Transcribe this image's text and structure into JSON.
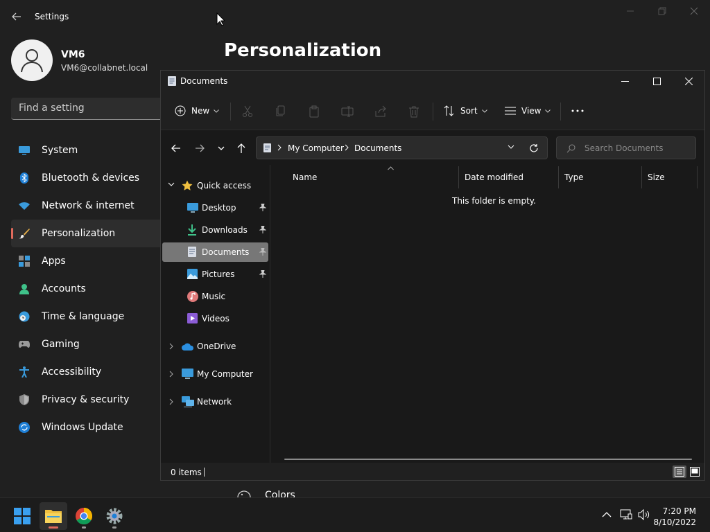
{
  "settings": {
    "title": "Settings",
    "profile": {
      "name": "VM6",
      "email": "VM6@collabnet.local"
    },
    "search_placeholder": "Find a setting",
    "page_title": "Personalization",
    "nav": [
      {
        "label": "System",
        "icon": "monitor-icon"
      },
      {
        "label": "Bluetooth & devices",
        "icon": "bluetooth-icon"
      },
      {
        "label": "Network & internet",
        "icon": "wifi-icon"
      },
      {
        "label": "Personalization",
        "icon": "brush-icon",
        "active": true
      },
      {
        "label": "Apps",
        "icon": "apps-icon"
      },
      {
        "label": "Accounts",
        "icon": "person-icon"
      },
      {
        "label": "Time & language",
        "icon": "clock-globe-icon"
      },
      {
        "label": "Gaming",
        "icon": "gamepad-icon"
      },
      {
        "label": "Accessibility",
        "icon": "accessibility-icon"
      },
      {
        "label": "Privacy & security",
        "icon": "shield-icon"
      },
      {
        "label": "Windows Update",
        "icon": "update-icon"
      }
    ],
    "colors_row_label": "Colors"
  },
  "explorer": {
    "title": "Documents",
    "toolbar": {
      "new_label": "New",
      "sort_label": "Sort",
      "view_label": "View"
    },
    "breadcrumb": [
      "My Computer",
      "Documents"
    ],
    "search_placeholder": "Search Documents",
    "tree": {
      "quick_access": "Quick access",
      "quick_items": [
        {
          "label": "Desktop",
          "pinned": true
        },
        {
          "label": "Downloads",
          "pinned": true
        },
        {
          "label": "Documents",
          "pinned": true,
          "selected": true
        },
        {
          "label": "Pictures",
          "pinned": true
        },
        {
          "label": "Music",
          "pinned": false
        },
        {
          "label": "Videos",
          "pinned": false
        }
      ],
      "onedrive": "OneDrive",
      "my_computer": "My Computer",
      "network": "Network"
    },
    "columns": [
      "Name",
      "Date modified",
      "Type",
      "Size"
    ],
    "empty_message": "This folder is empty.",
    "status_count": "0 items"
  },
  "taskbar": {
    "time": "7:20 PM",
    "date": "8/10/2022"
  },
  "colors": {
    "accent": "#e06a5c",
    "selection": "#777777",
    "folder": "#f0c040"
  }
}
